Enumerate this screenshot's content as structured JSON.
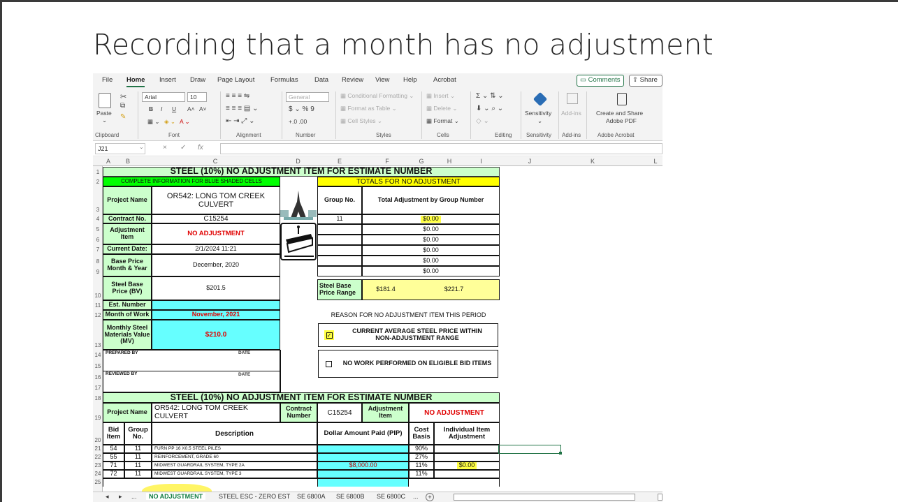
{
  "slide": {
    "title": "Recording that a month has no adjustment"
  },
  "menu": {
    "items": [
      "File",
      "Home",
      "Insert",
      "Draw",
      "Page Layout",
      "Formulas",
      "Data",
      "Review",
      "View",
      "Help",
      "Acrobat"
    ],
    "comments": "Comments",
    "share": "Share"
  },
  "ribbon": {
    "clipboard": {
      "label": "Clipboard",
      "paste": "Paste"
    },
    "font": {
      "label": "Font",
      "name": "Arial",
      "size": "10",
      "bold": "B",
      "italic": "I",
      "underline": "U",
      "grow": "A˄",
      "shrink": "A˅"
    },
    "alignment": {
      "label": "Alignment"
    },
    "number": {
      "label": "Number",
      "format": "General",
      "currency": "$",
      "percent": "%",
      "comma": "9",
      "inc": "+.0",
      "dec": ".00"
    },
    "styles": {
      "label": "Styles",
      "conditional": "Conditional Formatting",
      "format_table": "Format as Table",
      "cell_styles": "Cell Styles"
    },
    "cells": {
      "label": "Cells",
      "insert": "Insert",
      "delete": "Delete",
      "format": "Format"
    },
    "editing": {
      "label": "Editing"
    },
    "sensitivity": {
      "label": "Sensitivity",
      "btn": "Sensitivity"
    },
    "addins": {
      "label": "Add-ins",
      "btn": "Add-ins"
    },
    "acrobat": {
      "label": "Adobe Acrobat",
      "btn1": "Create and Share",
      "btn2": "Adobe PDF"
    }
  },
  "formula_bar": {
    "name_box": "J21",
    "cancel": "×",
    "enter": "✓",
    "fx": "fx"
  },
  "columns": [
    "A",
    "B",
    "C",
    "D",
    "E",
    "F",
    "G",
    "H",
    "I",
    "J",
    "K",
    "L"
  ],
  "rows": [
    "1",
    "2",
    "3",
    "4",
    "5",
    "6",
    "7",
    "8",
    "9",
    "10",
    "11",
    "12",
    "13",
    "14",
    "15",
    "16",
    "17",
    "18",
    "19",
    "20",
    "21",
    "22",
    "23",
    "24",
    "25"
  ],
  "sheet": {
    "title1": "STEEL (10%) NO ADJUSTMENT ITEM FOR ESTIMATE NUMBER",
    "complete_info": "COMPLETE INFORMATION FOR BLUE SHADED CELLS",
    "project_name_label": "Project Name",
    "project_name": "OR542: LONG TOM CREEK CULVERT",
    "contract_label": "Contract No.",
    "contract": "C15254",
    "adj_item_label": "Adjustment Item",
    "adj_item": "NO ADJUSTMENT",
    "current_date_label": "Current Date:",
    "current_date": "2/1/2024 11:21",
    "base_price_label": "Base Price Month & Year",
    "base_price_month": "December, 2020",
    "steel_base_label": "Steel Base Price (BV)",
    "steel_base": "$201.5",
    "est_number_label": "Est. Number",
    "month_of_work_label": "Month of Work",
    "month_of_work": "November, 2021",
    "mv_label": "Monthly Steel Materials Value (MV)",
    "mv": "$210.0",
    "prepared_by": "PREPARED BY",
    "reviewed_by": "REVIEWED BY",
    "date_label": "DATE",
    "totals_title": "TOTALS FOR NO ADJUSTMENT",
    "group_no_label": "Group No.",
    "total_adj_label": "Total Adjustment by Group Number",
    "totals": [
      {
        "group": "11",
        "amount": "$0.00"
      },
      {
        "group": "",
        "amount": "$0.00"
      },
      {
        "group": "",
        "amount": "$0.00"
      },
      {
        "group": "",
        "amount": "$0.00"
      },
      {
        "group": "",
        "amount": "$0.00"
      },
      {
        "group": "",
        "amount": "$0.00"
      }
    ],
    "range_label": "Steel Base Price Range",
    "range_low": "$181.4",
    "range_high": "$221.7",
    "reason_title": "REASON FOR NO ADJUSTMENT ITEM THIS PERIOD",
    "reason1": "CURRENT AVERAGE STEEL PRICE WITHIN NON-ADJUSTMENT RANGE",
    "reason1_checked": true,
    "reason2": "NO WORK PERFORMED ON ELIGIBLE BID ITEMS",
    "reason2_checked": false,
    "title2": "STEEL (10%) NO ADJUSTMENT ITEM FOR ESTIMATE NUMBER",
    "contract_number_label": "Contract Number",
    "adjustment_item_label": "Adjustment Item",
    "bid_item_label": "Bid Item",
    "group_no2_label": "Group No.",
    "description_label": "Description",
    "dollar_label": "Dollar Amount Paid (PIP)",
    "cost_basis_label": "Cost Basis",
    "individual_label": "Individual Item Adjustment",
    "items": [
      {
        "bid": "54",
        "group": "11",
        "desc": "FURN PP 16 X0.5 STEEL PILES",
        "paid": "",
        "basis": "90%",
        "adj": ""
      },
      {
        "bid": "55",
        "group": "11",
        "desc": "REINFORCEMENT, GRADE 60",
        "paid": "",
        "basis": "27%",
        "adj": ""
      },
      {
        "bid": "71",
        "group": "11",
        "desc": "MIDWEST GUARDRAIL SYSTEM, TYPE 2A",
        "paid": "$8,000.00",
        "basis": "11%",
        "adj": "$0.00"
      },
      {
        "bid": "72",
        "group": "11",
        "desc": "MIDWEST GUARDRAIL SYSTEM, TYPE 3",
        "paid": "",
        "basis": "11%",
        "adj": ""
      }
    ]
  },
  "tabs": {
    "ellipsis": "...",
    "active": "NO ADJUSTMENT",
    "others": [
      "STEEL ESC - ZERO EST",
      "SE 6800A",
      "SE 6800B",
      "SE 6800C"
    ],
    "more": "...",
    "add": "+"
  },
  "colors": {
    "highlight": "#ffff44",
    "green_header": "#ccffcc",
    "bright_green": "#00ff00",
    "cyan": "#66ffff",
    "yellow": "#ffff99",
    "excel_green": "#217346"
  }
}
